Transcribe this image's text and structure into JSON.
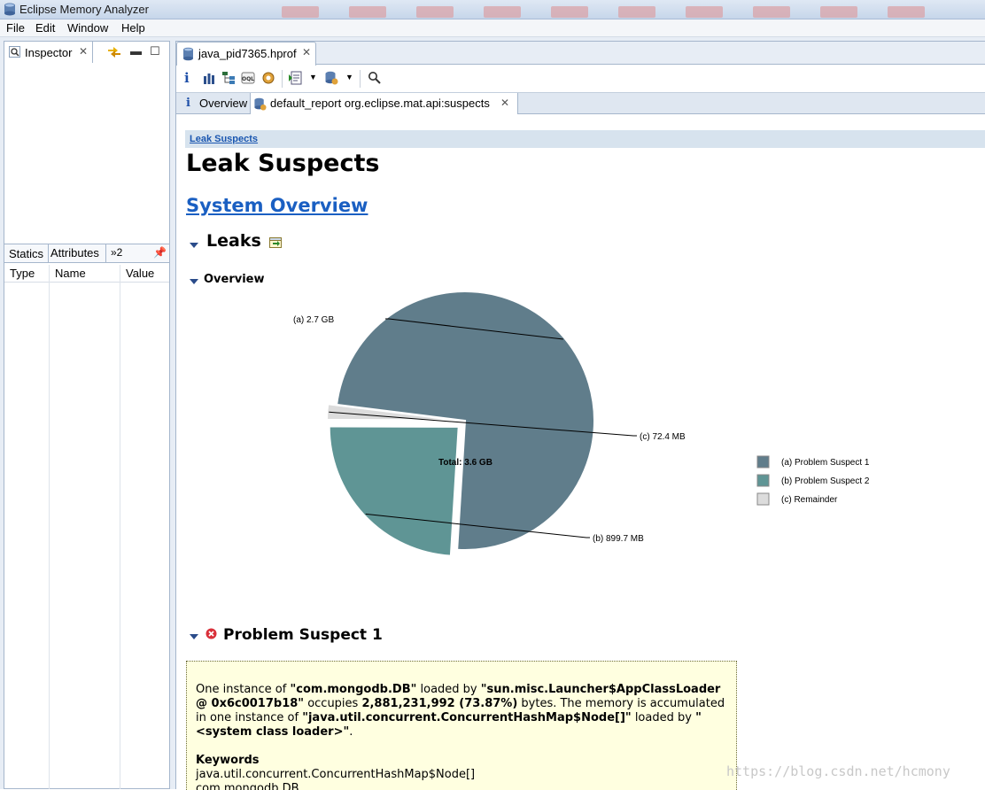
{
  "window": {
    "title": "Eclipse Memory Analyzer"
  },
  "menu": [
    "File",
    "Edit",
    "Window",
    "Help"
  ],
  "inspector": {
    "tab_label": "Inspector",
    "subtabs": [
      "Statics",
      "Attributes",
      "»2"
    ],
    "columns": [
      "Type",
      "Name",
      "Value"
    ]
  },
  "editor": {
    "file_tab": "java_pid7365.hprof",
    "subtabs": {
      "overview": "Overview",
      "report": "default_report  org.eclipse.mat.api:suspects"
    }
  },
  "report": {
    "breadcrumb": "Leak Suspects",
    "title": "Leak Suspects",
    "system_overview_link": "System Overview",
    "leaks_heading": "Leaks",
    "overview_heading": "Overview",
    "problem_suspect_heading": "Problem Suspect 1",
    "suspect_text": {
      "p1_a": "One instance of ",
      "p1_class": "\"com.mongodb.DB\"",
      "p1_b": " loaded by ",
      "p1_loader": "\"sun.misc.Launcher$AppClassLoader @ 0x6c0017b18\"",
      "p1_c": " occupies ",
      "p1_bytes": "2,881,231,992 (73.87%)",
      "p1_d": " bytes. The memory is accumulated in one instance of ",
      "p1_holder": "\"java.util.concurrent.ConcurrentHashMap$Node[]\"",
      "p1_e": " loaded by ",
      "p1_holder_loader": "\"<system class loader>\"",
      "p1_f": ".",
      "keywords_label": "Keywords",
      "keywords": [
        "java.util.concurrent.ConcurrentHashMap$Node[]",
        "com.mongodb.DB"
      ]
    }
  },
  "watermark": "https://blog.csdn.net/hcmony",
  "colors": {
    "suspect1": "#607d8b",
    "suspect2": "#5f9595",
    "remainder": "#dcdcdc"
  },
  "chart_data": {
    "type": "pie",
    "total_label": "Total: 3.6 GB",
    "slices": [
      {
        "id": "(a)",
        "name": "Problem Suspect 1",
        "value_gb": 2.7,
        "label": "2.7 GB",
        "color": "#607d8b"
      },
      {
        "id": "(b)",
        "name": "Problem Suspect 2",
        "value_gb": 0.8786,
        "label": "899.7 MB",
        "color": "#5f9595"
      },
      {
        "id": "(c)",
        "name": "Remainder",
        "value_gb": 0.0707,
        "label": "72.4 MB",
        "color": "#dcdcdc"
      }
    ],
    "legend_position": "right"
  }
}
